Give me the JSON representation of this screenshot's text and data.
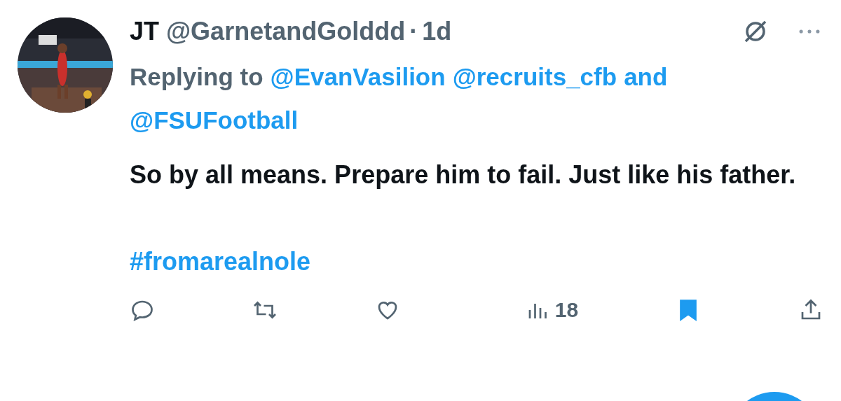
{
  "tweet": {
    "author_name": "JT",
    "handle": "@GarnetandGolddd",
    "separator": "·",
    "time": "1d",
    "reply_prefix": "Replying to",
    "reply_targets": [
      "@EvanVasilion",
      "@recruits_cfb",
      "@FSUFootball"
    ],
    "reply_conjunction": "and",
    "text": "So by all means. Prepare him to fail. Just like his father.",
    "hashtag": "#fromarealnole"
  },
  "actions": [
    {
      "kind": "reply"
    },
    {
      "kind": "retweet"
    },
    {
      "kind": "like",
      "selected": false
    },
    {
      "kind": "views",
      "count": "18"
    },
    {
      "kind": "bookmark",
      "selected": true
    },
    {
      "kind": "share"
    }
  ]
}
